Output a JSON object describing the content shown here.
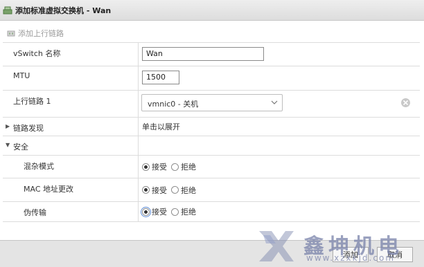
{
  "dialog": {
    "title": "添加标准虚拟交换机 - Wan"
  },
  "toolbar": {
    "add_uplink_label": "添加上行链路",
    "add_uplink_icon": "network-adapter-icon"
  },
  "form": {
    "vswitch_name": {
      "label": "vSwitch 名称",
      "value": "Wan"
    },
    "mtu": {
      "label": "MTU",
      "value": "1500"
    },
    "uplink1": {
      "label": "上行链路 1",
      "selected": "vmnic0 - 关机"
    },
    "link_discovery": {
      "label": "链路发现",
      "value": "单击以展开",
      "expanded": false
    },
    "security": {
      "label": "安全",
      "expanded": true,
      "options": {
        "accept": "接受",
        "reject": "拒绝"
      },
      "promiscuous": {
        "label": "混杂模式",
        "selected": "接受"
      },
      "mac_changes": {
        "label": "MAC 地址更改",
        "selected": "接受"
      },
      "forged_transmits": {
        "label": "伪传输",
        "selected": "接受"
      }
    }
  },
  "footer": {
    "add_label": "添加",
    "cancel_label": "取消"
  },
  "watermark": {
    "text": "鑫坤机电",
    "url": "www.xzxkjd.com"
  },
  "colors": {
    "border": "#dcdcdc",
    "footer_bg": "#e4e4e4",
    "titlebar_bg": "#dddddd",
    "watermark": "#7882aa"
  }
}
